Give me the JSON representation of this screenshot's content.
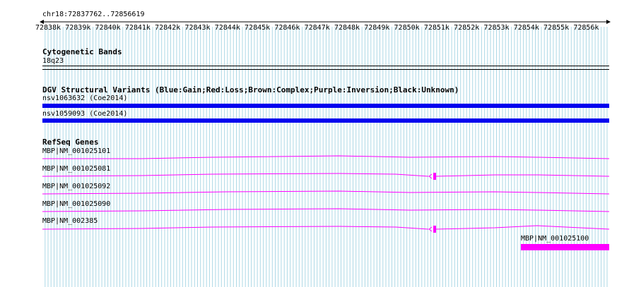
{
  "ruler": {
    "location": "chr18:72837762..72856619",
    "ticks": [
      "72838k",
      "72839k",
      "72840k",
      "72841k",
      "72842k",
      "72843k",
      "72844k",
      "72845k",
      "72846k",
      "72847k",
      "72848k",
      "72849k",
      "72850k",
      "72851k",
      "72852k",
      "72853k",
      "72854k",
      "72855k",
      "72856k"
    ]
  },
  "tracks": {
    "cytobands": {
      "title": "Cytogenetic Bands",
      "band_label": "18q23"
    },
    "dgv": {
      "title": "DGV Structural Variants (Blue:Gain;Red:Loss;Brown:Complex;Purple:Inversion;Black:Unknown)",
      "items": [
        {
          "label": "nsv1063632 (Coe2014)",
          "color": "#0000ee"
        },
        {
          "label": "nsv1059093 (Coe2014)",
          "color": "#0000ee"
        }
      ]
    },
    "refseq": {
      "title": "RefSeq Genes",
      "color": "#ff00ff",
      "genes": [
        {
          "label": "MBP|NM_001025101"
        },
        {
          "label": "MBP|NM_001025081"
        },
        {
          "label": "MBP|NM_001025092"
        },
        {
          "label": "MBP|NM_001025090"
        },
        {
          "label": "MBP|NM_002385"
        },
        {
          "label": "MBP|NM_001025100"
        }
      ]
    }
  },
  "colors": {
    "grid_line": "#add8e6",
    "major_grid_line": "#87bcd0",
    "gene": "#ff00ff",
    "gain": "#0000ee"
  }
}
